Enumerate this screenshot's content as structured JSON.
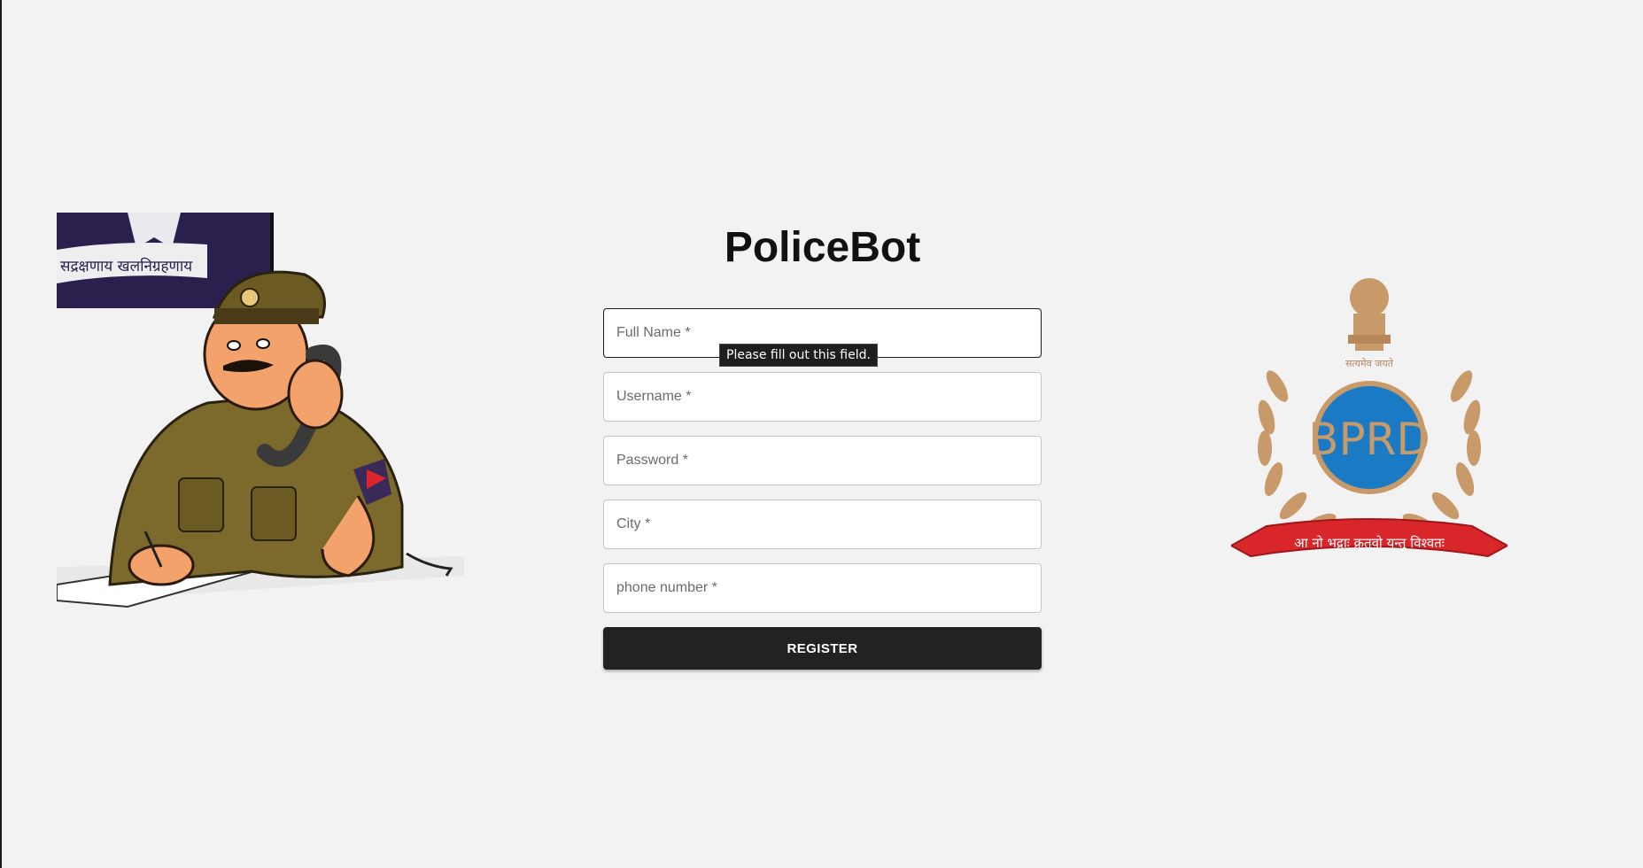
{
  "app": {
    "title": "PoliceBot"
  },
  "form": {
    "fields": [
      {
        "name": "full-name",
        "placeholder": "Full Name *",
        "value": ""
      },
      {
        "name": "username",
        "placeholder": "Username *",
        "value": ""
      },
      {
        "name": "password",
        "placeholder": "Password *",
        "value": ""
      },
      {
        "name": "city",
        "placeholder": "City *",
        "value": ""
      },
      {
        "name": "phone-number",
        "placeholder": "phone number *",
        "value": ""
      }
    ],
    "submit_label": "REGISTER",
    "validation_tooltip": "Please fill out this field."
  },
  "illustration": {
    "banner_text": "सद्रक्षणाय खलनिग्रहणाय"
  },
  "emblem": {
    "motto_top": "सत्यमेव जयते",
    "center_text": "BPRD",
    "ribbon_text": "आ नो भद्राः क्रतवो यन्तु विश्वतः"
  },
  "colors": {
    "background": "#f2f2f2",
    "button": "#222222",
    "emblem_blue": "#1a7bc4",
    "emblem_gold": "#c89a6a",
    "ribbon_red": "#d8262a"
  }
}
